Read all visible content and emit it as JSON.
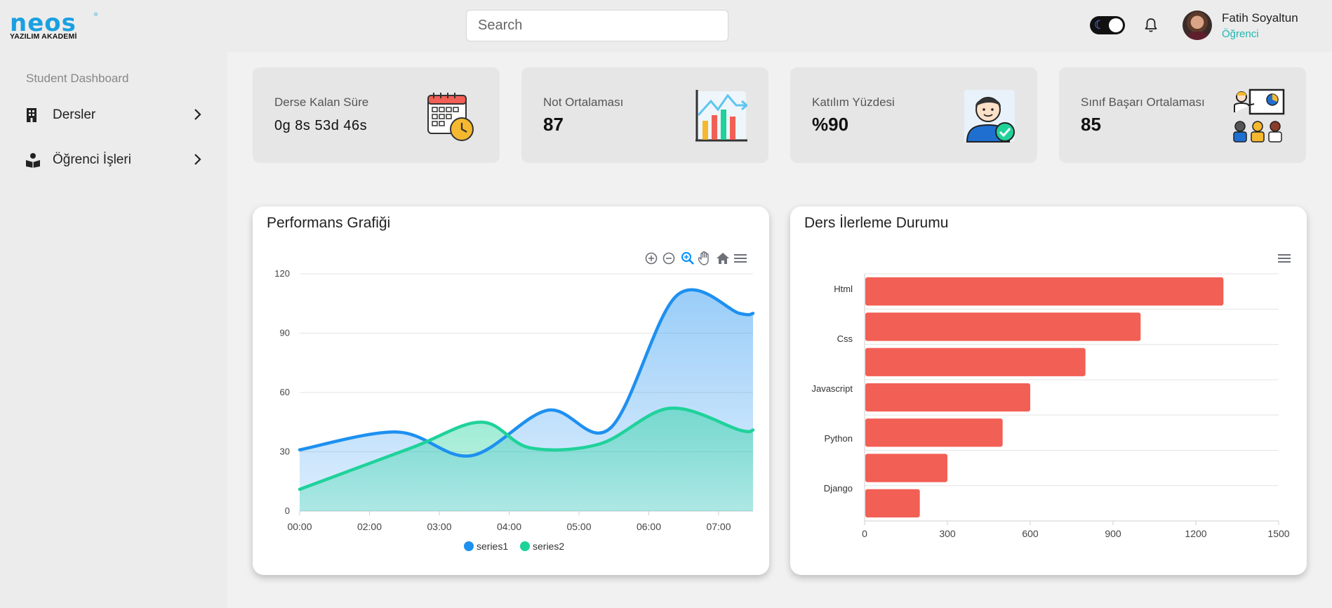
{
  "brand": {
    "logo_text": "neos",
    "logo_sub": "YAZILIM AKADEMİ",
    "logo_mark": "®"
  },
  "search": {
    "placeholder": "Search",
    "value": ""
  },
  "user": {
    "name": "Fatih Soyaltun",
    "role": "Öğrenci"
  },
  "sidebar": {
    "section_title": "Student Dashboard",
    "items": [
      {
        "label": "Dersler",
        "icon": "building-icon"
      },
      {
        "label": "Öğrenci İşleri",
        "icon": "reading-book-icon"
      }
    ]
  },
  "stats": [
    {
      "title": "Derse Kalan Süre",
      "value": "0g 8s 53d 46s",
      "icon": "calendar-clock-icon"
    },
    {
      "title": "Not Ortalaması",
      "value": "87",
      "icon": "bar-chart-growth-icon"
    },
    {
      "title": "Katılım Yüzdesi",
      "value": "%90",
      "icon": "student-check-icon"
    },
    {
      "title": "Sınıf Başarı Ortalaması",
      "value": "85",
      "icon": "classroom-presentation-icon"
    }
  ],
  "colors": {
    "series1": "#1e90f0",
    "series2": "#1fd29a",
    "bar": "#f25f55",
    "accent": "#1fb8b0"
  },
  "chart_data": [
    {
      "type": "area",
      "title": "Performans Grafiği",
      "x": [
        "00:00",
        "02:00",
        "03:00",
        "04:00",
        "05:00",
        "06:00",
        "07:00"
      ],
      "ylim": [
        0,
        120
      ],
      "yticks": [
        0,
        30,
        60,
        90,
        120
      ],
      "series": [
        {
          "name": "series1",
          "x": [
            0,
            1.4,
            2.45,
            3.55,
            4.45,
            5.4,
            6.3,
            7.25
          ],
          "values": [
            31,
            40,
            28,
            51,
            42,
            109,
            100,
            100
          ]
        },
        {
          "name": "series2",
          "x": [
            0,
            1.6,
            2.6,
            3.3,
            4.3,
            5.3,
            6.3,
            7.25
          ],
          "values": [
            11,
            32,
            45,
            32,
            34,
            52,
            41,
            41
          ]
        }
      ],
      "legend": "bottom-center",
      "grid": true
    },
    {
      "type": "bar",
      "orientation": "horizontal",
      "title": "Ders İlerleme Durumu",
      "categories": [
        "Html",
        "",
        "Css",
        "",
        "Javascript",
        "",
        "Python",
        "",
        "Django"
      ],
      "values": [
        1300,
        1000,
        800,
        600,
        500,
        300,
        200
      ],
      "category_labels": [
        "Html",
        "Css",
        "Javascript",
        "Python",
        "Django"
      ],
      "xlim": [
        0,
        1500
      ],
      "xticks": [
        0,
        300,
        600,
        900,
        1200,
        1500
      ],
      "grid": true
    }
  ]
}
